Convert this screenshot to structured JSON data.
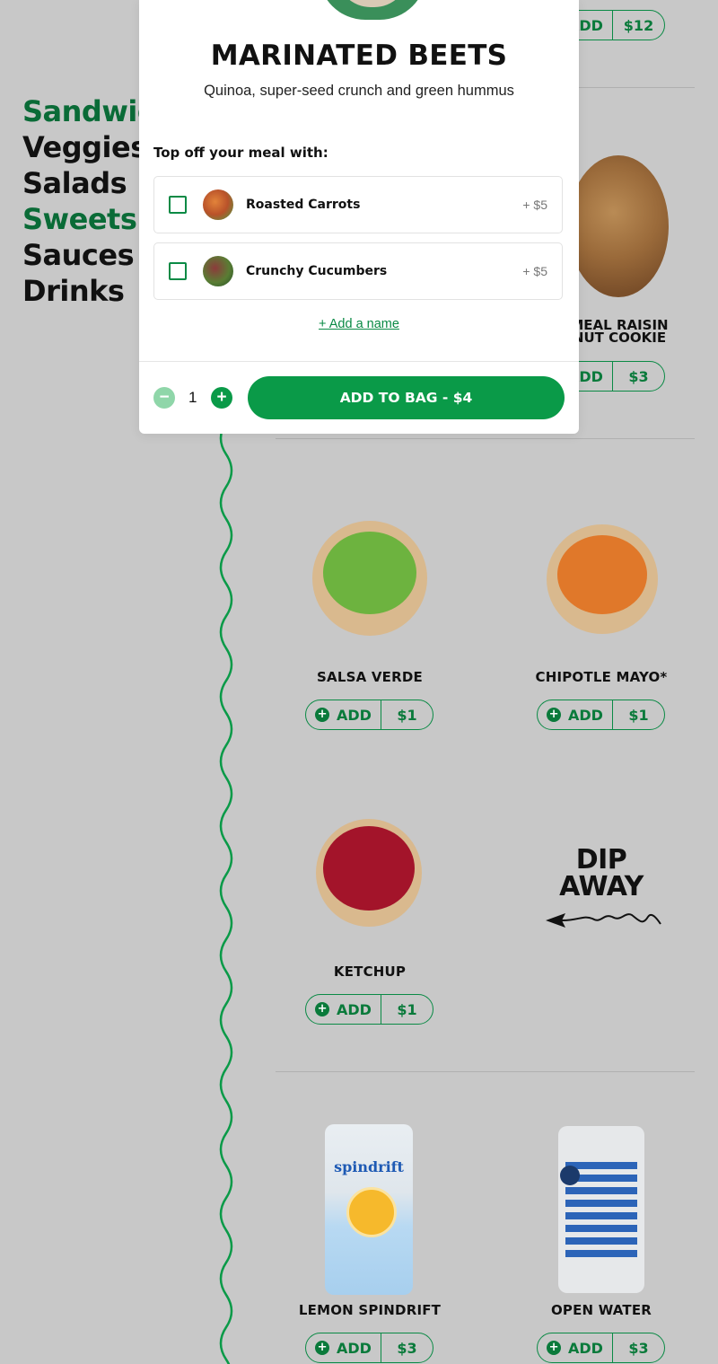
{
  "nav": {
    "items": [
      {
        "label": "Sandwiches",
        "visible_text": "Sandwic"
      },
      {
        "label": "Veggies"
      },
      {
        "label": "Salads"
      },
      {
        "label": "Sweets"
      },
      {
        "label": "Sauces"
      },
      {
        "label": "Drinks"
      }
    ]
  },
  "top_partial": {
    "add_label": "ADD",
    "price": "$12"
  },
  "cookie": {
    "name_line1": "MEAL RAISIN",
    "name_line2": "NUT COOKIE",
    "add_label": "ADD",
    "price": "$3"
  },
  "items": [
    {
      "name": "SALSA VERDE",
      "add_label": "ADD",
      "price": "$1",
      "color": "#6db33f"
    },
    {
      "name": "CHIPOTLE MAYO*",
      "add_label": "ADD",
      "price": "$1",
      "color": "#e0782a"
    },
    {
      "name": "KETCHUP",
      "add_label": "ADD",
      "price": "$1",
      "color": "#a3142a"
    },
    {
      "name": "LEMON SPINDRIFT",
      "add_label": "ADD",
      "price": "$3"
    },
    {
      "name": "OPEN WATER",
      "add_label": "ADD",
      "price": "$3"
    }
  ],
  "dip": {
    "line1": "DIP",
    "line2": "AWAY"
  },
  "modal": {
    "title": "MARINATED BEETS",
    "description": "Quinoa, super-seed crunch and green hummus",
    "topoff_label": "Top off your meal with:",
    "options": [
      {
        "name": "Roasted Carrots",
        "price": "+ $5"
      },
      {
        "name": "Crunchy Cucumbers",
        "price": "+ $5"
      }
    ],
    "add_name_link": "+ Add a name",
    "quantity": "1",
    "minus": "−",
    "plus": "+",
    "add_to_bag": "ADD TO BAG - $4"
  },
  "colors": {
    "brand_green": "#0a9a48",
    "dark_green": "#0a6b37",
    "background": "#c8c8c8"
  }
}
